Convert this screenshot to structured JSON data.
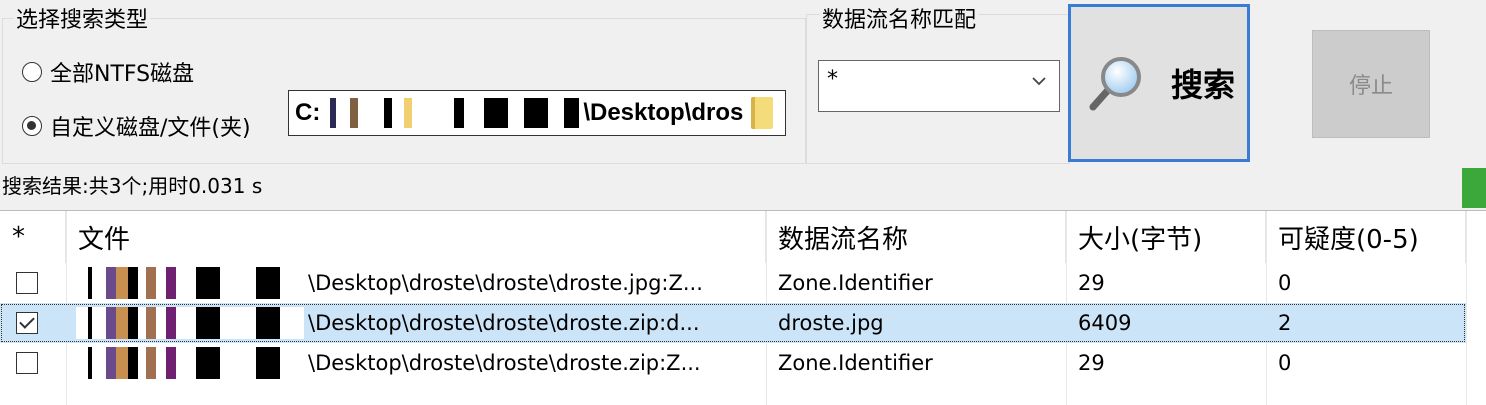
{
  "search_type": {
    "title": "选择搜索类型",
    "option_all": "全部NTFS磁盘",
    "option_custom": "自定义磁盘/文件(夹)",
    "selected": "custom",
    "path_prefix": "C:",
    "path_suffix": "\\Desktop\\dros"
  },
  "stream_match": {
    "title": "数据流名称匹配",
    "value": "*"
  },
  "buttons": {
    "search": "搜索",
    "stop": "停止"
  },
  "status": "搜索结果:共3个;用时0.031 s",
  "table": {
    "headers": [
      "*",
      "文件",
      "数据流名称",
      "大小(字节)",
      "可疑度(0-5)"
    ],
    "rows": [
      {
        "checked": false,
        "file": "\\Desktop\\droste\\droste\\droste.jpg:Z...",
        "stream": "Zone.Identifier",
        "size": "29",
        "suspicion": "0",
        "selected": false
      },
      {
        "checked": true,
        "file": "\\Desktop\\droste\\droste\\droste.zip:d...",
        "stream": "droste.jpg",
        "size": "6409",
        "suspicion": "2",
        "selected": true
      },
      {
        "checked": false,
        "file": "\\Desktop\\droste\\droste\\droste.zip:Z...",
        "stream": "Zone.Identifier",
        "size": "29",
        "suspicion": "0",
        "selected": false
      }
    ]
  },
  "colors": {
    "accent": "#3a7bd5",
    "selection": "#cce4f7",
    "progress": "#3ca83c"
  },
  "icons": [
    "folder-icon",
    "magnifier-icon",
    "chevron-down-icon"
  ]
}
